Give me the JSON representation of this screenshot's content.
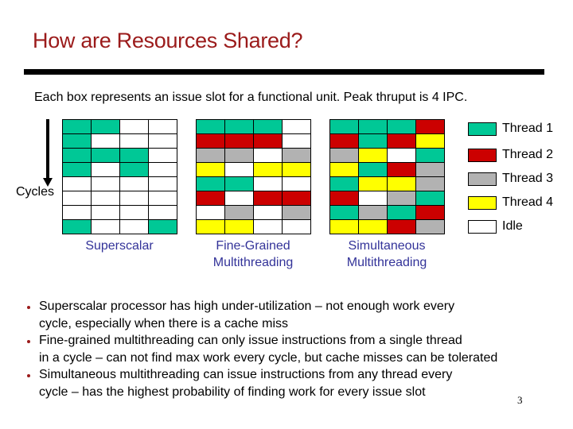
{
  "title": "How are Resources Shared?",
  "subtitle": "Each box represents an issue slot for a functional unit. Peak thruput is 4 IPC.",
  "axis": {
    "label": "Cycles",
    "direction": "down"
  },
  "colors": {
    "T1": "#00c896",
    "T2": "#cc0000",
    "T3": "#b2b2b2",
    "T4": "#ffff00",
    "I": "#ffffff"
  },
  "legend": [
    {
      "key": "T1",
      "label": "Thread 1"
    },
    {
      "key": "T2",
      "label": "Thread 2"
    },
    {
      "key": "T3",
      "label": "Thread 3"
    },
    {
      "key": "T4",
      "label": "Thread 4"
    },
    {
      "key": "I",
      "label": "Idle"
    }
  ],
  "grids": [
    {
      "id": "superscalar",
      "label_lines": [
        "Superscalar"
      ],
      "rows": [
        [
          "T1",
          "T1",
          "I",
          "I"
        ],
        [
          "T1",
          "I",
          "I",
          "I"
        ],
        [
          "T1",
          "T1",
          "T1",
          "I"
        ],
        [
          "T1",
          "I",
          "T1",
          "I"
        ],
        [
          "I",
          "I",
          "I",
          "I"
        ],
        [
          "I",
          "I",
          "I",
          "I"
        ],
        [
          "I",
          "I",
          "I",
          "I"
        ],
        [
          "T1",
          "I",
          "I",
          "T1"
        ]
      ]
    },
    {
      "id": "fine",
      "label_lines": [
        "Fine-Grained",
        "Multithreading"
      ],
      "rows": [
        [
          "T1",
          "T1",
          "T1",
          "I"
        ],
        [
          "T2",
          "T2",
          "T2",
          "I"
        ],
        [
          "T3",
          "T3",
          "I",
          "T3"
        ],
        [
          "T4",
          "I",
          "T4",
          "T4"
        ],
        [
          "T1",
          "T1",
          "I",
          "I"
        ],
        [
          "T2",
          "I",
          "T2",
          "T2"
        ],
        [
          "I",
          "T3",
          "I",
          "T3"
        ],
        [
          "T4",
          "T4",
          "I",
          "I"
        ]
      ]
    },
    {
      "id": "smt",
      "label_lines": [
        "Simultaneous",
        "Multithreading"
      ],
      "rows": [
        [
          "T1",
          "T1",
          "T1",
          "T2"
        ],
        [
          "T2",
          "T1",
          "T2",
          "T4"
        ],
        [
          "T3",
          "T4",
          "I",
          "T1"
        ],
        [
          "T4",
          "T1",
          "T2",
          "T3"
        ],
        [
          "T1",
          "T4",
          "T4",
          "T3"
        ],
        [
          "T2",
          "I",
          "T3",
          "T1"
        ],
        [
          "T1",
          "T3",
          "T1",
          "T2"
        ],
        [
          "T4",
          "T4",
          "T2",
          "T3"
        ]
      ]
    }
  ],
  "bullets": [
    [
      "Superscalar processor has high under-utilization – not enough work every",
      "cycle, especially when there is a cache miss"
    ],
    [
      "Fine-grained multithreading can only issue instructions from a single thread",
      "in a cycle – can not find max work every cycle, but cache misses can be tolerated"
    ],
    [
      "Simultaneous multithreading can issue instructions from any thread every",
      "cycle – has the highest probability of finding work for every issue slot"
    ]
  ],
  "page_number": "3"
}
